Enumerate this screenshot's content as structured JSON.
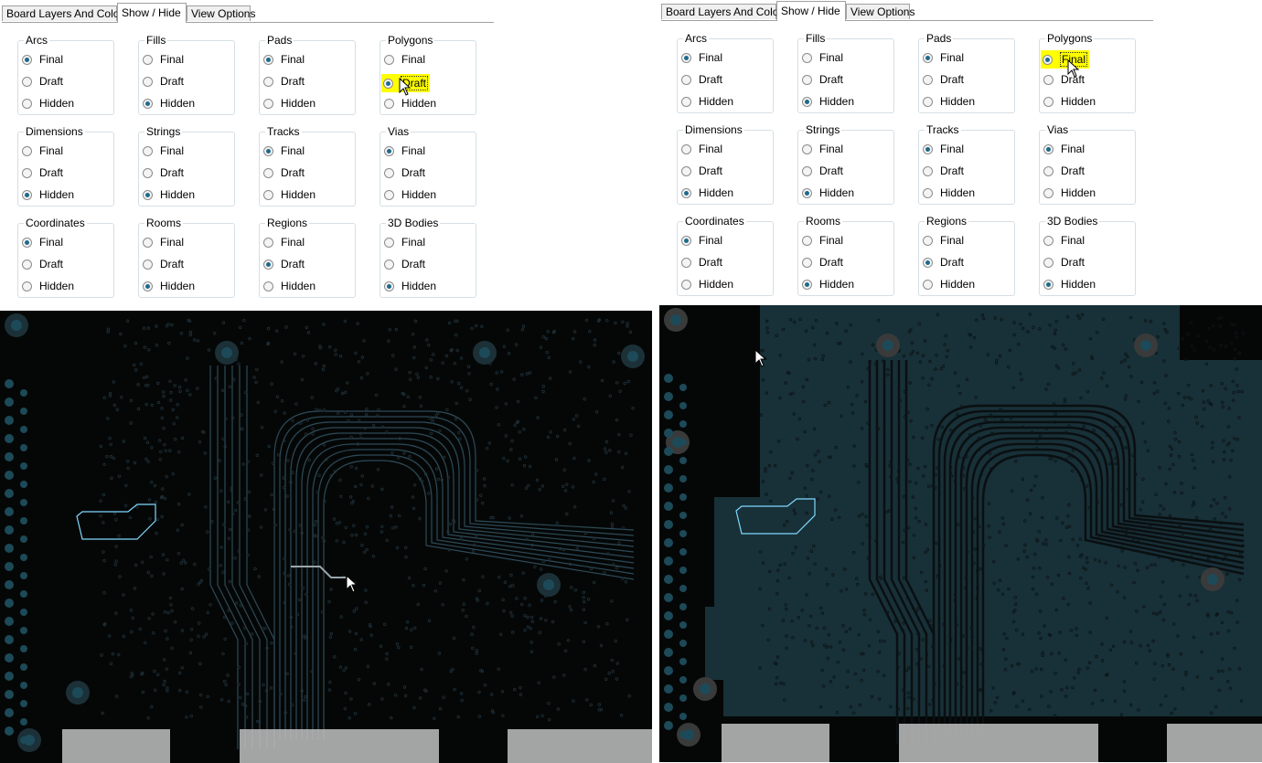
{
  "tabs": [
    "Board Layers And Colors",
    "Show / Hide",
    "View Options"
  ],
  "active_tab": "Show / Hide",
  "options": [
    "Final",
    "Draft",
    "Hidden"
  ],
  "groups": [
    "Arcs",
    "Fills",
    "Pads",
    "Polygons",
    "Dimensions",
    "Strings",
    "Tracks",
    "Vias",
    "Coordinates",
    "Rooms",
    "Regions",
    "3D Bodies"
  ],
  "left_selection": {
    "Arcs": "Final",
    "Fills": "Hidden",
    "Pads": "Final",
    "Polygons": "Draft",
    "Dimensions": "Hidden",
    "Strings": "Hidden",
    "Tracks": "Final",
    "Vias": "Final",
    "Coordinates": "Final",
    "Rooms": "Hidden",
    "Regions": "Draft",
    "3D Bodies": "Hidden"
  },
  "right_selection": {
    "Arcs": "Final",
    "Fills": "Hidden",
    "Pads": "Final",
    "Polygons": "Final",
    "Dimensions": "Hidden",
    "Strings": "Hidden",
    "Tracks": "Final",
    "Vias": "Final",
    "Coordinates": "Final",
    "Rooms": "Hidden",
    "Regions": "Draft",
    "3D Bodies": "Hidden"
  },
  "highlight": {
    "left": "Polygons",
    "right": "Polygons"
  },
  "colors": {
    "board_bg": "#050707",
    "polygon_fill": "#183038",
    "track": "#2d4a57",
    "highlight": "#ffff00",
    "radio_dot": "#1d6a8c",
    "footprint": "#c0c0c0"
  }
}
